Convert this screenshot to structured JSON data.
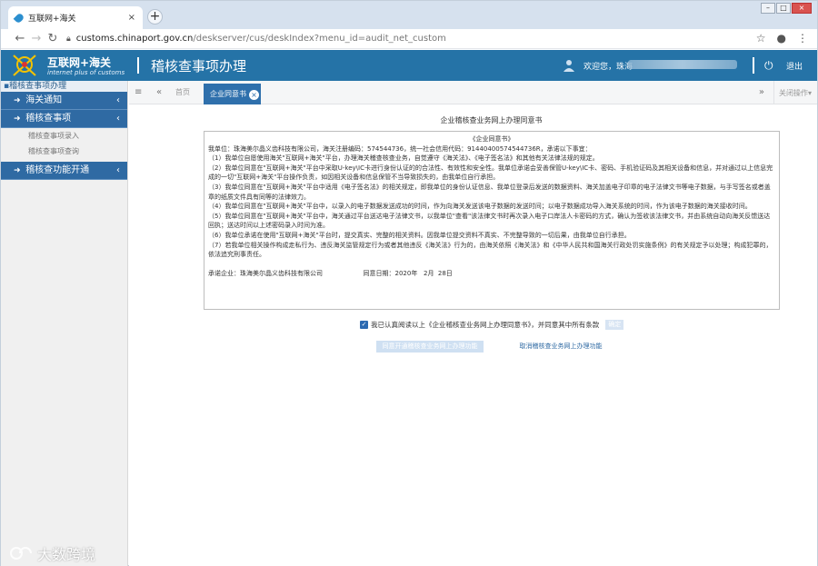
{
  "browser": {
    "tab_title": "互联网+海关",
    "tab_close": "×",
    "new_tab": "+",
    "url_domain": "customs.chinaport.gov.cn",
    "url_path": "/deskserver/cus/deskIndex?menu_id=audit_net_custom"
  },
  "header": {
    "brand": "互联网+海关",
    "brand_sub": "internet plus of customs",
    "title": "稽核查事项办理",
    "welcome": "欢迎您，珠海",
    "logout": "退出"
  },
  "sidebar": {
    "title": "稽核查事项办理",
    "groups": [
      {
        "label": "海关通知",
        "chevron": "‹"
      },
      {
        "label": "稽核查事项",
        "chevron": "‹",
        "items": [
          "稽核查事项录入",
          "稽核查事项查询"
        ]
      },
      {
        "label": "稽核查功能开通",
        "chevron": "‹"
      }
    ]
  },
  "content_toolbar": {
    "home_tab": "首页",
    "active_tab": "企业同意书",
    "close_ops": "关闭操作▾"
  },
  "agreement": {
    "heading": "企业稽核查业务网上办理同意书",
    "box_title": "《企业同意书》",
    "lines": [
      "我单位：珠海美尔晶义齿科技有限公司，海关注册编码：574544736，统一社会信用代码：91440400574544736R，承诺以下事宜：",
      "（1）我单位自愿使用海关\"互联网+海关\"平台，办理海关稽查核查业务，自觉遵守《海关法》、《电子签名法》和其他有关法律法规的规定。",
      "（2）我单位同意在\"互联网+海关\"平台中采取U-key\\IC卡进行身份认证的的合法性、有效性和安全性。我单位承诺会妥善保管U-key\\IC卡、密码、手机验证码及其相关设备和信息，并对通过以上信息完成的一切\"互联网+海关\"平台操作负责，如因相关设备和信息保管不当导致损失的，由我单位自行承担。",
      "（3）我单位同意在\"互联网+海关\"平台中适用《电子签名法》的相关规定，即我单位的身份认证信息、我单位登录后发送的数据资料、海关加盖电子印章的电子法律文书等电子数据，与手写签名或者盖章的纸质文件具有同等的法律效力。",
      "（4）我单位同意在\"互联网+海关\"平台中，以录入的电子数据发送成功的时间，作为向海关发送该电子数据的发送时间；以电子数据成功导入海关系统的时间，作为该电子数据的海关接收时间。",
      "（5）我单位同意在\"互联网+海关\"平台中，海关通过平台送达电子法律文书，以我单位\"查看\"该法律文书时再次录入电子口岸法人卡密码的方式，确认为签收该法律文书，并由系统自动向海关反馈送达回执；送达时间以上述密码录入时间为准。",
      "（6）我单位承诺在使用\"互联网+海关\"平台时，提交真实、完整的相关资料。因我单位提交资料不真实、不完整导致的一切后果，由我单位自行承担。",
      "（7）若我单位相关操作构成走私行为、违反海关监管规定行为或者其他违反《海关法》行为的，由海关依照《海关法》和《中华人民共和国海关行政处罚实施条例》的有关规定予以处理；构成犯罪的，依法追究刑事责任。"
    ],
    "signature": "承诺企业：珠海美尔晶义齿科技有限公司                    同意日期：2020年   2月  28日",
    "confirm_text": "我已认真阅读以上《企业稽核查业务网上办理同意书》，并同意其中所有条款",
    "confirm_ok": "确定",
    "agree_button": "同意开通稽核查业务网上办理功能",
    "cancel_button": "取消稽核查业务网上办理功能"
  },
  "watermark": "大数跨境",
  "colors": {
    "header_blue": "#2573a7",
    "sidebar_blue": "#2f6aa3",
    "tab_active": "#2f70ac"
  }
}
